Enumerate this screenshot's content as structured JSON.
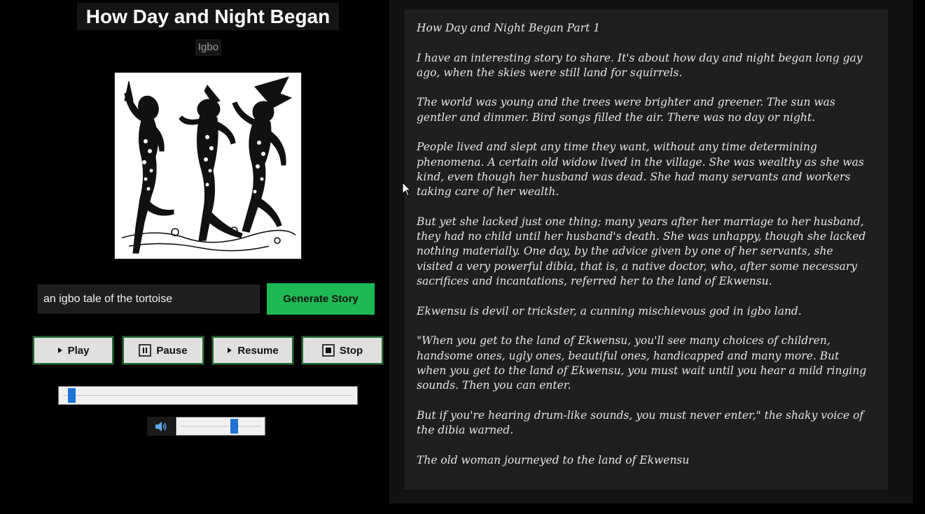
{
  "story": {
    "title": "How Day and Night Began",
    "language": "Igbo",
    "image_icon": "dancing-masquerade-figures-illustration"
  },
  "generator": {
    "prompt_value": "an igbo tale of the tortoise",
    "generate_label": "Generate Story",
    "accent_color": "#1db954"
  },
  "controls": {
    "play_label": "Play",
    "pause_label": "Pause",
    "resume_label": "Resume",
    "stop_label": "Stop"
  },
  "audio": {
    "seek_fraction": 0.03,
    "volume_fraction": 0.67,
    "volume_icon": "speaker-icon",
    "slider_color": "#1e73d6"
  },
  "story_text": {
    "paragraphs": [
      "How Day and Night Began Part 1",
      "I have an interesting story to share. It's about how day and night began long gay ago, when the skies were still land for squirrels.",
      "The world was young and the trees were brighter and greener. The sun was gentler and dimmer. Bird songs filled the air. There was no day or night.",
      "People lived and slept any time they want, without any time determining phenomena. A certain old widow lived in the village. She was wealthy as she was kind, even though her husband was dead. She had many servants and workers taking care of her wealth.",
      "But yet she lacked just one thing; many years after her marriage to her husband, they had no child until her husband's death. She was unhappy, though she lacked nothing materially. One day, by the advice given by one of her servants, she visited a very powerful dibia, that is, a native doctor, who, after some necessary sacrifices and incantations, referred her to the land of Ekwensu.",
      "Ekwensu is devil or trickster, a cunning mischievous god in igbo land.",
      "\"When you get to the land of Ekwensu, you'll see many choices of children, handsome ones, ugly ones, beautiful ones, handicapped and many more. But when you get to the land of Ekwensu, you must wait until you hear a mild ringing sounds. Then you can enter.",
      "But if you're hearing drum-like sounds, you must never enter,\" the shaky voice of the dibia warned.",
      "The old woman journeyed to the land of Ekwensu"
    ]
  }
}
